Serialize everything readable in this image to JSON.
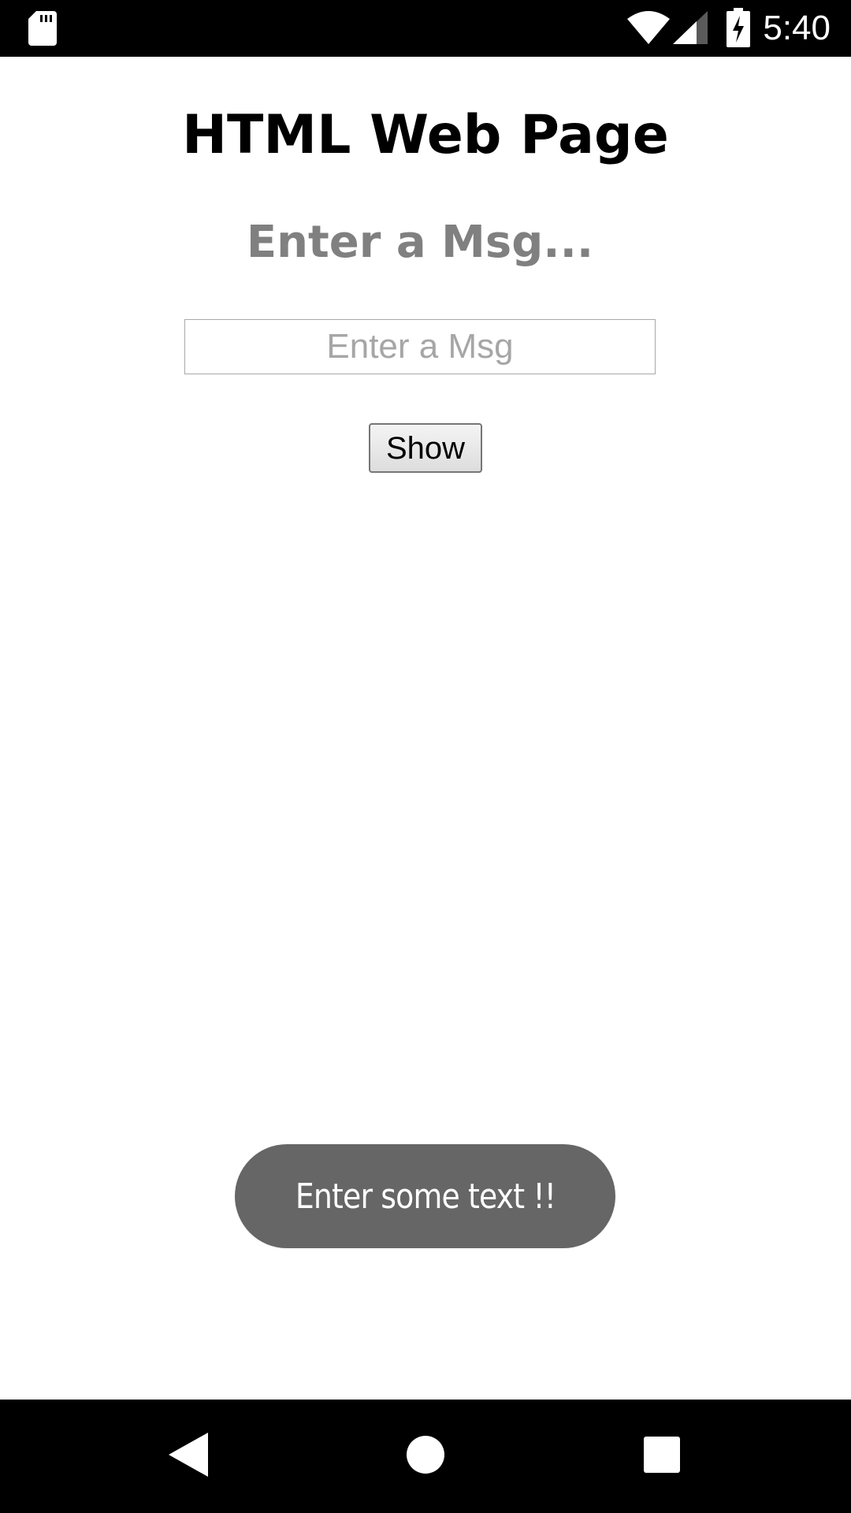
{
  "status_bar": {
    "time": "5:40",
    "icons": [
      "sd-card-icon",
      "wifi-icon",
      "signal-icon",
      "battery-charging-icon"
    ]
  },
  "page": {
    "title": "HTML Web Page",
    "prompt_heading": "Enter a Msg...",
    "message_input": {
      "value": "",
      "placeholder": "Enter a Msg"
    },
    "show_button_label": "Show"
  },
  "toast": {
    "message": "Enter some text !!"
  },
  "nav_bar": {
    "icons": [
      "back-icon",
      "home-icon",
      "recents-icon"
    ]
  },
  "colors": {
    "status_bar_bg": "#000000",
    "page_bg": "#ffffff",
    "prompt_heading": "#808080",
    "toast_bg": "#666666",
    "toast_text": "#ffffff"
  }
}
